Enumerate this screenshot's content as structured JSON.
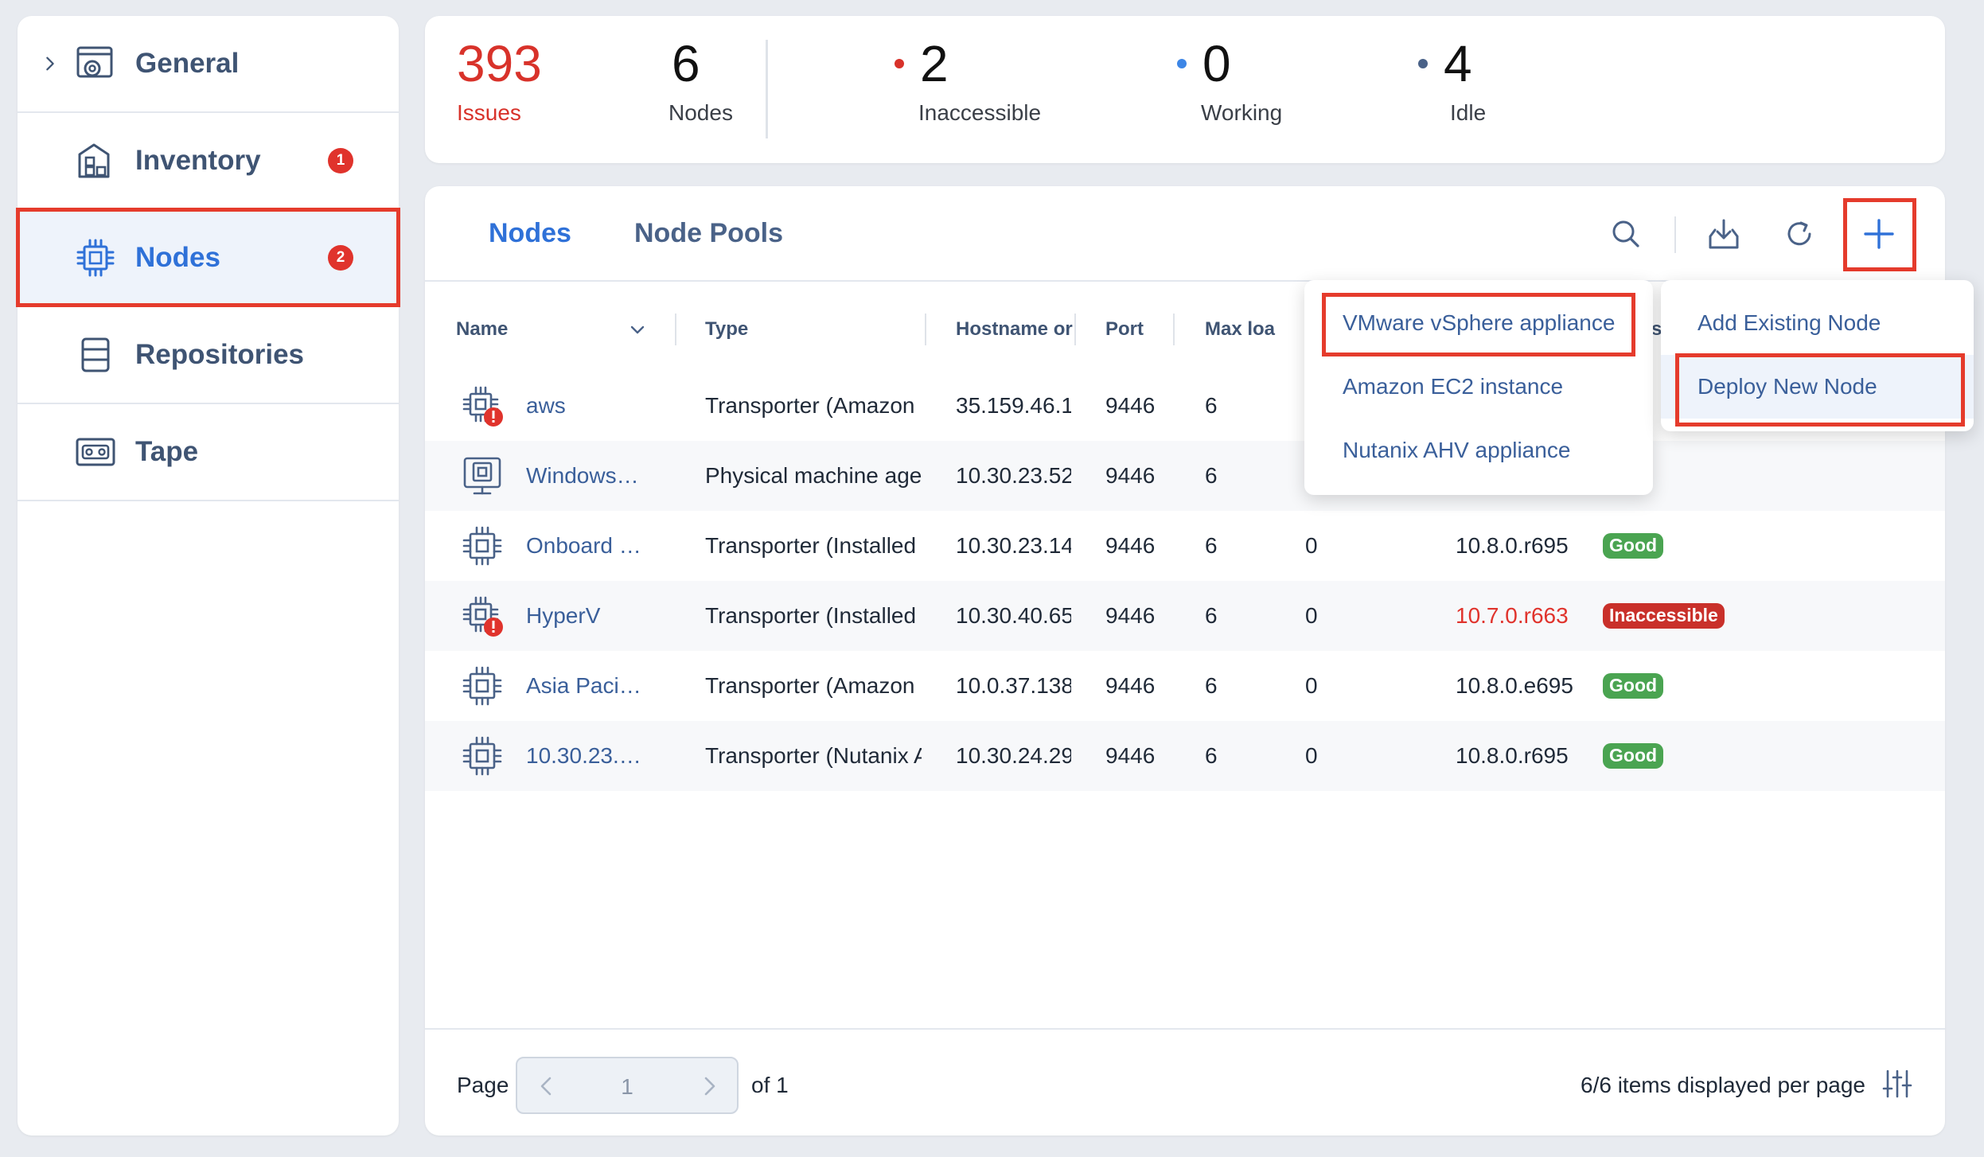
{
  "sidebar": {
    "items": [
      {
        "label": "General",
        "icon": "gear-window-icon",
        "badge": ""
      },
      {
        "label": "Inventory",
        "icon": "buildings-icon",
        "badge": "1"
      },
      {
        "label": "Nodes",
        "icon": "chip-icon",
        "badge": "2"
      },
      {
        "label": "Repositories",
        "icon": "database-icon",
        "badge": ""
      },
      {
        "label": "Tape",
        "icon": "tape-icon",
        "badge": ""
      }
    ]
  },
  "summary": {
    "issues": {
      "value": "393",
      "label": "Issues"
    },
    "nodes": {
      "value": "6",
      "label": "Nodes"
    },
    "inaccessible": {
      "value": "2",
      "label": "Inaccessible"
    },
    "working": {
      "value": "0",
      "label": "Working"
    },
    "idle": {
      "value": "4",
      "label": "Idle"
    }
  },
  "tabs": {
    "nodes": "Nodes",
    "node_pools": "Node Pools"
  },
  "table": {
    "headers": {
      "name": "Name",
      "type": "Type",
      "hostname": "Hostname or",
      "port": "Port",
      "max_load": "Max loa",
      "status_partial": "s"
    },
    "rows": [
      {
        "name": "aws",
        "type": "Transporter (Amazon E",
        "hostname": "35.159.46.1",
        "port": "9446",
        "max_load": "6",
        "current": "",
        "version": "",
        "status": "",
        "warn": true
      },
      {
        "name": "Windows…",
        "type": "Physical machine age",
        "hostname": "10.30.23.52",
        "port": "9446",
        "max_load": "6",
        "current": "",
        "version": "",
        "status": "",
        "warn": false
      },
      {
        "name": "Onboard …",
        "type": "Transporter (Installed",
        "hostname": "10.30.23.14",
        "port": "9446",
        "max_load": "6",
        "current": "0",
        "version": "10.8.0.r695",
        "status": "Good",
        "warn": false
      },
      {
        "name": "HyperV",
        "type": "Transporter (Installed",
        "hostname": "10.30.40.65",
        "port": "9446",
        "max_load": "6",
        "current": "0",
        "version": "10.7.0.r663",
        "status": "Inaccessible",
        "warn": true
      },
      {
        "name": "Asia Paci…",
        "type": "Transporter (Amazon E",
        "hostname": "10.0.37.138",
        "port": "9446",
        "max_load": "6",
        "current": "0",
        "version": "10.8.0.e695",
        "status": "Good",
        "warn": false
      },
      {
        "name": "10.30.23.…",
        "type": "Transporter (Nutanix A",
        "hostname": "10.30.24.29",
        "port": "9446",
        "max_load": "6",
        "current": "0",
        "version": "10.8.0.r695",
        "status": "Good",
        "warn": false
      }
    ]
  },
  "pager": {
    "page_label": "Page",
    "current_page": "1",
    "of_label": "of 1",
    "info": "6/6 items displayed per page"
  },
  "deploy_menu": {
    "items": [
      "VMware vSphere appliance",
      "Amazon EC2 instance",
      "Nutanix AHV appliance"
    ]
  },
  "add_menu": {
    "items": [
      "Add Existing Node",
      "Deploy New Node"
    ]
  },
  "colors": {
    "accent": "#2f71d8",
    "danger": "#e0332c",
    "good": "#4aa451",
    "highlight_outline": "#e53b2c"
  }
}
